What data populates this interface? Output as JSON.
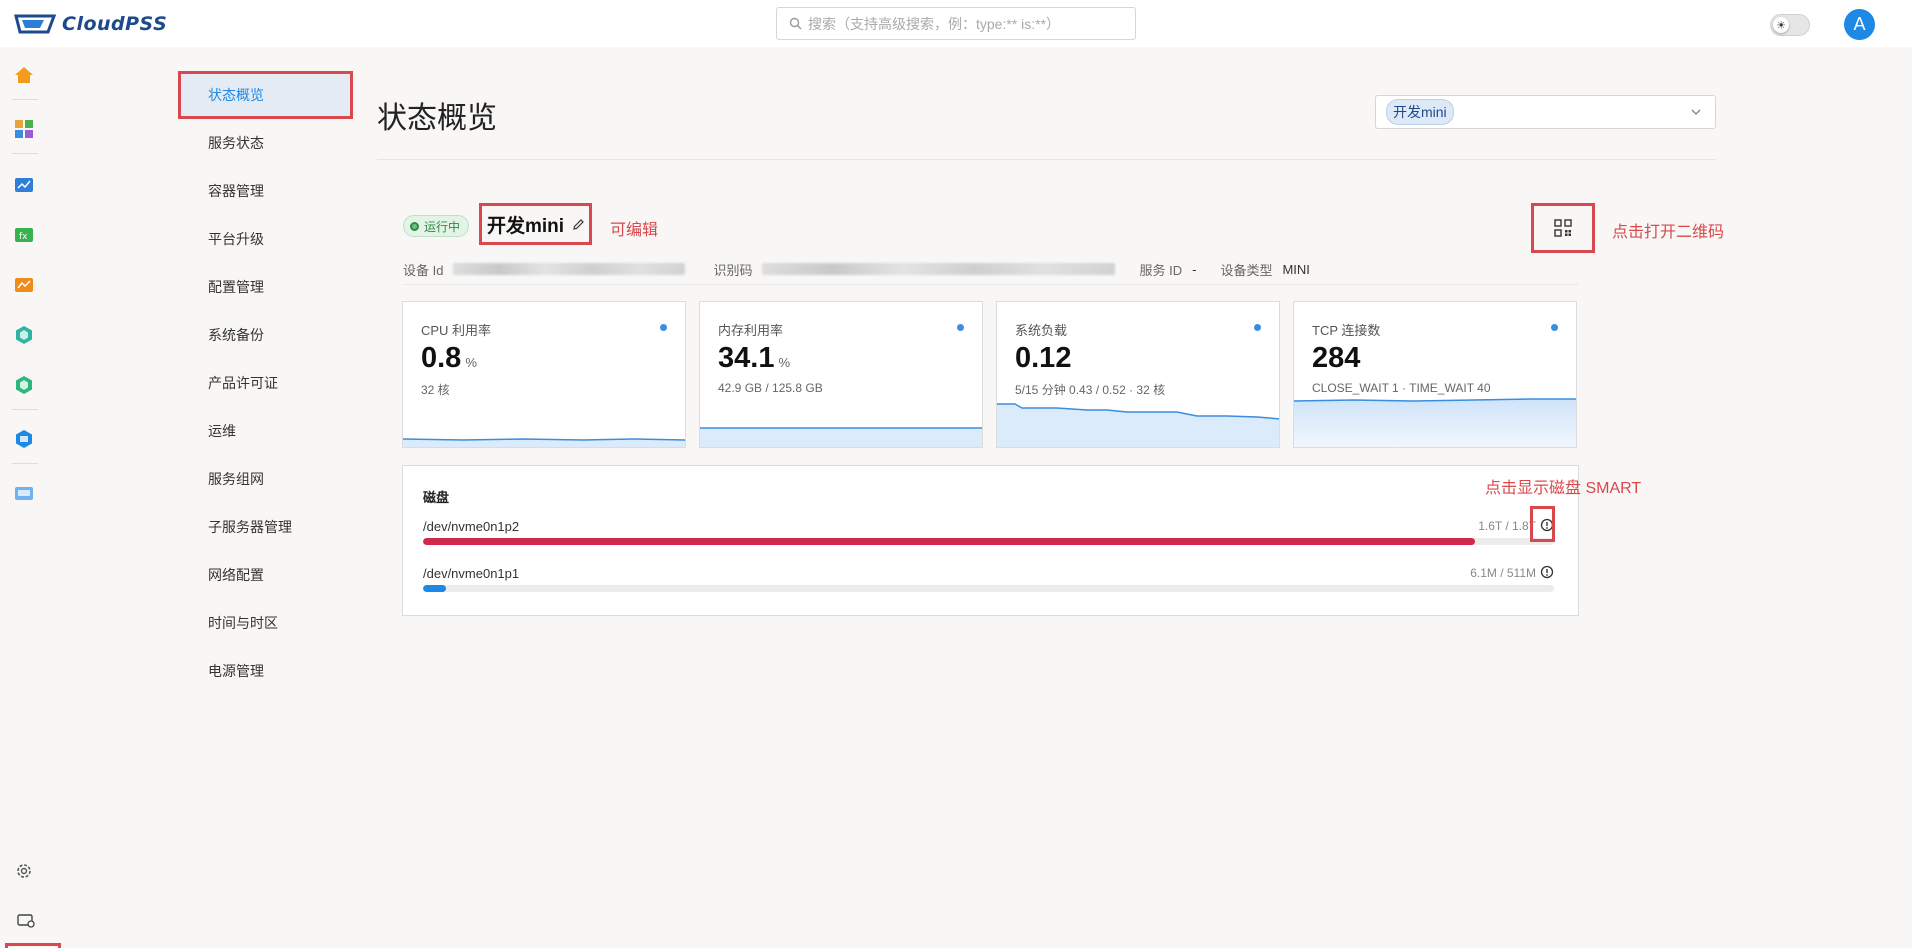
{
  "app": {
    "logo_text": "CloudPSS"
  },
  "search": {
    "placeholder": "搜索（支持高级搜索，例：type:** is:**）"
  },
  "user": {
    "avatar_initial": "A"
  },
  "rail": {
    "icons": [
      "home-icon",
      "apps-icon",
      "monitor-chart-icon",
      "function-icon",
      "trend-icon",
      "hex-app-icon",
      "hex-app-2-icon",
      "shield-app-icon",
      "files-icon",
      "settings-icon",
      "server-admin-icon"
    ]
  },
  "menu": {
    "items": [
      {
        "label": "状态概览",
        "active": true
      },
      {
        "label": "服务状态"
      },
      {
        "label": "容器管理"
      },
      {
        "label": "平台升级"
      },
      {
        "label": "配置管理"
      },
      {
        "label": "系统备份"
      },
      {
        "label": "产品许可证"
      },
      {
        "label": "运维"
      },
      {
        "label": "服务组网"
      },
      {
        "label": "子服务器管理"
      },
      {
        "label": "网络配置"
      },
      {
        "label": "时间与时区"
      },
      {
        "label": "电源管理"
      }
    ]
  },
  "page": {
    "title": "状态概览",
    "device_selector": {
      "selected": "开发mini"
    }
  },
  "device": {
    "status": "运行中",
    "name": "开发mini",
    "edit_annotation": "可编辑",
    "qr_annotation": "点击打开二维码",
    "meta": {
      "device_id_label": "设备 Id",
      "code_label": "识别码",
      "service_id_label": "服务 ID",
      "service_id_value": "-",
      "device_type_label": "设备类型",
      "device_type_value": "MINI"
    }
  },
  "metrics": [
    {
      "label": "CPU 利用率",
      "value": "0.8",
      "unit": "%",
      "sub": "32 核"
    },
    {
      "label": "内存利用率",
      "value": "34.1",
      "unit": "%",
      "sub": "42.9 GB / 125.8 GB"
    },
    {
      "label": "系统负载",
      "value": "0.12",
      "unit": "",
      "sub": "5/15 分钟 0.43 / 0.52 · 32 核"
    },
    {
      "label": "TCP 连接数",
      "value": "284",
      "unit": "",
      "sub": "CLOSE_WAIT 1 · TIME_WAIT 40"
    }
  ],
  "disks": {
    "title": "磁盘",
    "smart_annotation": "点击显示磁盘 SMART",
    "items": [
      {
        "name": "/dev/nvme0n1p2",
        "usage": "1.6T / 1.8T",
        "fraction": 0.93,
        "color": "#cf2a4a"
      },
      {
        "name": "/dev/nvme0n1p1",
        "usage": "6.1M / 511M",
        "fraction": 0.02,
        "color": "#1e88e5"
      }
    ]
  },
  "colors": {
    "accent": "#1e88e5",
    "annotation": "#d9484c",
    "running": "#2e8b47"
  }
}
